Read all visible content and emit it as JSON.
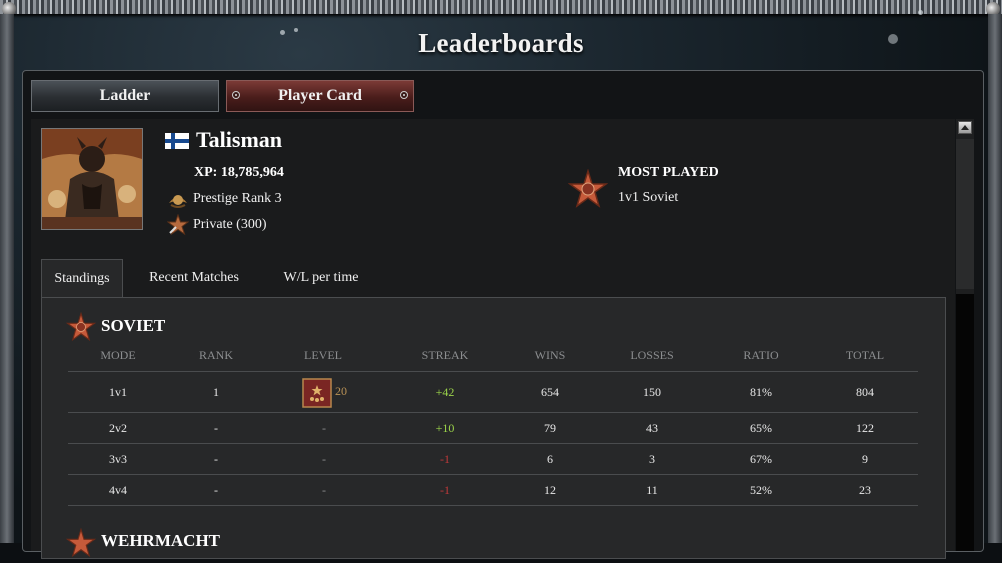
{
  "window": {
    "title": "Leaderboards"
  },
  "top_tabs": [
    {
      "label": "Ladder"
    },
    {
      "label": "Player Card"
    }
  ],
  "player": {
    "name": "Talisman",
    "xp": "XP: 18,785,964",
    "prestige": "Prestige Rank 3",
    "rank": "Private (300)"
  },
  "most_played": {
    "label": "MOST PLAYED",
    "value": "1v1 Soviet"
  },
  "sub_tabs": [
    {
      "label": "Standings"
    },
    {
      "label": "Recent Matches"
    },
    {
      "label": "W/L per time"
    }
  ],
  "standings": {
    "faction": "SOVIET",
    "columns": [
      "MODE",
      "RANK",
      "LEVEL",
      "STREAK",
      "WINS",
      "LOSSES",
      "RATIO",
      "TOTAL"
    ],
    "rows": [
      {
        "mode": "1v1",
        "rank": "1",
        "level": "20",
        "streak": "+42",
        "wins": "654",
        "losses": "150",
        "ratio": "81%",
        "total": "804"
      },
      {
        "mode": "2v2",
        "rank": "-",
        "level": "-",
        "streak": "+10",
        "wins": "79",
        "losses": "43",
        "ratio": "65%",
        "total": "122"
      },
      {
        "mode": "3v3",
        "rank": "-",
        "level": "-",
        "streak": "-1",
        "wins": "6",
        "losses": "3",
        "ratio": "67%",
        "total": "9"
      },
      {
        "mode": "4v4",
        "rank": "-",
        "level": "-",
        "streak": "-1",
        "wins": "12",
        "losses": "11",
        "ratio": "52%",
        "total": "23"
      }
    ],
    "next_faction": "WEHRMACHT"
  },
  "colors": {
    "streak_positive": "#9bd34a",
    "streak_negative": "#c0393a",
    "active_tab": "#5a2624"
  }
}
